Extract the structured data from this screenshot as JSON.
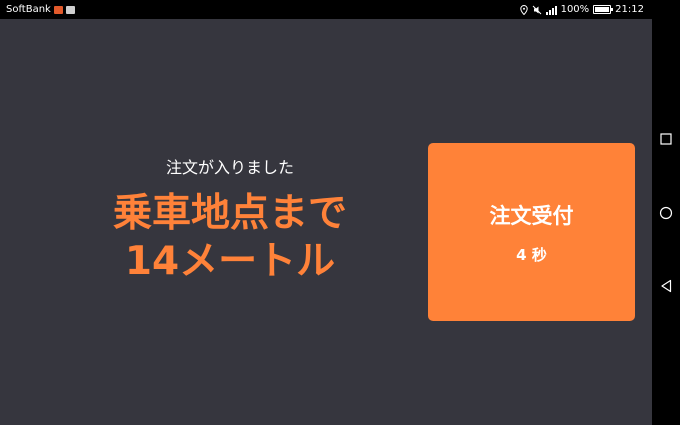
{
  "status_bar": {
    "carrier": "SoftBank",
    "battery_percent": "100%",
    "battery_level": 1.0,
    "time": "21:12",
    "icons": [
      "carrier-badge-icon",
      "carrier-status-icon",
      "location-icon",
      "mute-icon",
      "signal-icon",
      "battery-icon"
    ]
  },
  "main": {
    "notice": "注文が入りました",
    "headline_line1": "乗車地点まで",
    "headline_line2": "14メートル"
  },
  "accept_button": {
    "label": "注文受付",
    "countdown": "4 秒"
  },
  "nav_bar": {
    "icons": [
      "square-recent-icon",
      "circle-home-icon",
      "triangle-back-icon"
    ]
  },
  "colors": {
    "background": "#36363e",
    "accent": "#ff8238",
    "text": "#ffffff"
  }
}
